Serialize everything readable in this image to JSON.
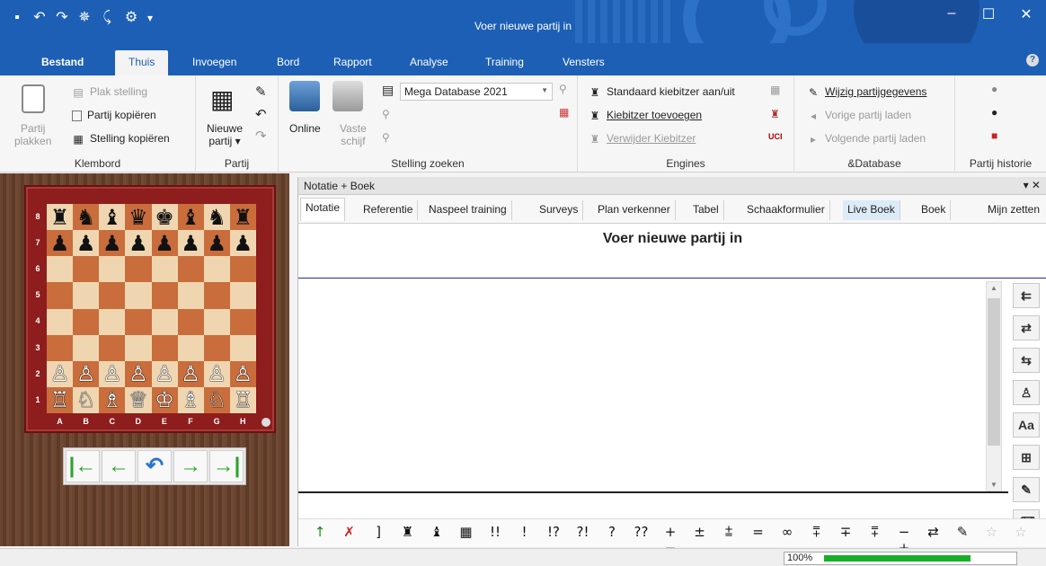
{
  "window": {
    "title": "Voer nieuwe partij in",
    "quick_access": [
      "save-icon",
      "undo-icon",
      "redo-icon",
      "engine-icon",
      "move-icon",
      "gear-icon",
      "customize-icon"
    ],
    "controls": {
      "minimize": "‒",
      "maximize": "☐",
      "close": "✕"
    }
  },
  "ribbon_tabs": [
    "Bestand",
    "Thuis",
    "Invoegen",
    "Bord",
    "Rapport",
    "Analyse",
    "Training",
    "Vensters"
  ],
  "active_tab": "Thuis",
  "ribbon": {
    "klembord": {
      "label": "Klembord",
      "paste": "Partij\nplakken",
      "paste_line1": "Partij",
      "paste_line2": "plakken",
      "items": [
        "Plak stelling",
        "Partij kopiëren",
        "Stelling kopiëren"
      ]
    },
    "partij": {
      "label": "Partij",
      "new_line1": "Nieuwe",
      "new_line2": "partij ▾"
    },
    "stelling": {
      "label": "Stelling zoeken",
      "online": "Online",
      "vaste_line1": "Vaste",
      "vaste_line2": "schijf",
      "database": "Mega Database 2021"
    },
    "engines": {
      "label": "Engines",
      "items": [
        "Standaard kiebitzer aan/uit",
        "Kiebitzer toevoegen",
        "Verwijder Kiebitzer"
      ]
    },
    "database": {
      "label": "&Database",
      "items": [
        "Wijzig partijgegevens",
        "Vorige partij laden",
        "Volgende partij laden"
      ]
    },
    "historie": {
      "label": "Partij historie"
    }
  },
  "board": {
    "ranks": [
      "8",
      "7",
      "6",
      "5",
      "4",
      "3",
      "2",
      "1"
    ],
    "files": [
      "A",
      "B",
      "C",
      "D",
      "E",
      "F",
      "G",
      "H"
    ],
    "position": [
      "♜♞♝♛♚♝♞♜",
      "♟♟♟♟♟♟♟♟",
      "        ",
      "        ",
      "        ",
      "        ",
      "♙♙♙♙♙♙♙♙",
      "♖♘♗♕♔♗♘♖"
    ]
  },
  "nav_buttons": {
    "first": "|←",
    "back": "←",
    "undo": "↶",
    "forward": "→",
    "last": "→|"
  },
  "notation": {
    "panel_title": "Notatie + Boek",
    "panel_controls": "▾ ✕",
    "tabs": [
      "Notatie",
      "Referentie",
      "Naspeel training",
      "Surveys",
      "Plan verkenner",
      "Tabel",
      "Schaakformulier",
      "Live Boek",
      "Boek",
      "Mijn zetten"
    ],
    "active_tab": "Notatie",
    "game_title": "Voer nieuwe partij in",
    "side_tools": [
      "⇇",
      "⇄",
      "⇆",
      "♙",
      "Aa",
      "⊞",
      "✎",
      "⌫"
    ],
    "symbols": [
      "↑",
      "✗",
      "]",
      "♜",
      "♝",
      "▦",
      "!!",
      "!",
      "!?",
      "?!",
      "?",
      "??",
      "+−",
      "±",
      "⩲",
      "=",
      "∞",
      "⩱",
      "∓",
      "⩱",
      "−+",
      "⇄",
      "✎",
      "☆",
      "☆"
    ]
  },
  "status": {
    "zoom": "100%",
    "zoom_level": 0.72
  }
}
